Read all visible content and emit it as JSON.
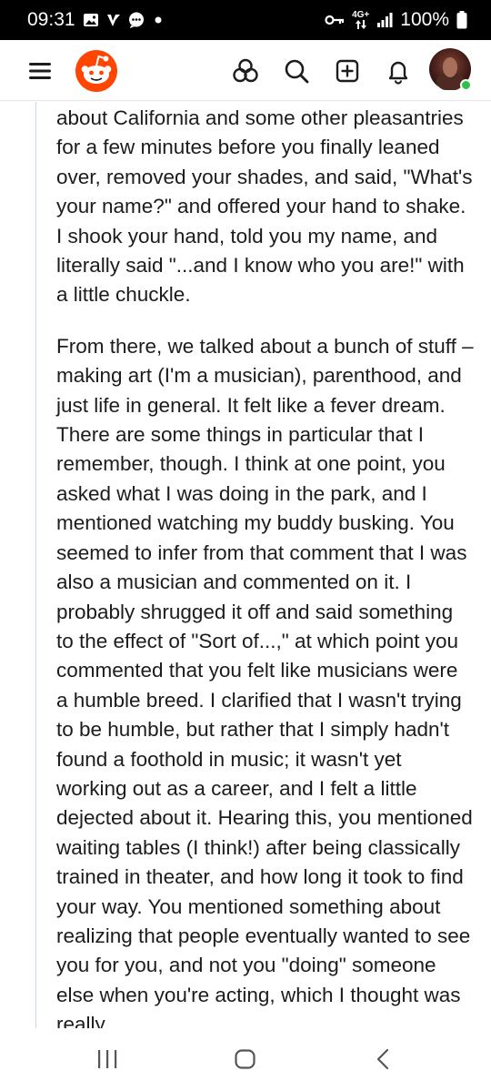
{
  "status_bar": {
    "time": "09:31",
    "network_top": "4G+",
    "battery_percent": "100%",
    "icons": [
      "gallery-icon",
      "v-notification-icon",
      "chat-icon",
      "more-dot-icon",
      "key-icon",
      "signal-icon",
      "battery-icon"
    ]
  },
  "header": {
    "icons": [
      "menu-icon",
      "reddit-logo",
      "popular-icon",
      "search-icon",
      "create-post-icon",
      "notifications-icon",
      "avatar"
    ],
    "colors": {
      "brand": "#ff4500",
      "online": "#2ec04a"
    }
  },
  "comment": {
    "paragraphs": [
      "about California and some other pleasantries for a few minutes before you finally leaned over, removed your shades, and said, \"What's your name?\" and offered your hand to shake. I shook your hand, told you my name, and literally said \"...and I know who you are!\" with a little chuckle.",
      "From there, we talked about a bunch of stuff – making art (I'm a musician), parenthood, and just life in general. It felt like a fever dream. There are some things in particular that I remember, though. I think at one point, you asked what I was doing in the park, and I mentioned watching my buddy busking. You seemed to infer from that comment that I was also a musician and commented on it. I probably shrugged it off and said something to the effect of \"Sort of...,\" at which point you commented that you felt like musicians were a humble breed. I clarified that I wasn't trying to be humble, but rather that I simply hadn't found a foothold in music; it wasn't yet working out as a career, and I felt a little dejected about it. Hearing this, you mentioned waiting tables (I think!) after being classically trained in theater, and how long it took to find your way. You mentioned something about realizing that people eventually wanted to see you for you, and not you \"doing\" someone else when you're acting, which I thought was really"
    ]
  },
  "nav_bar": {
    "icons": [
      "recent-apps-icon",
      "home-icon",
      "back-icon"
    ]
  }
}
